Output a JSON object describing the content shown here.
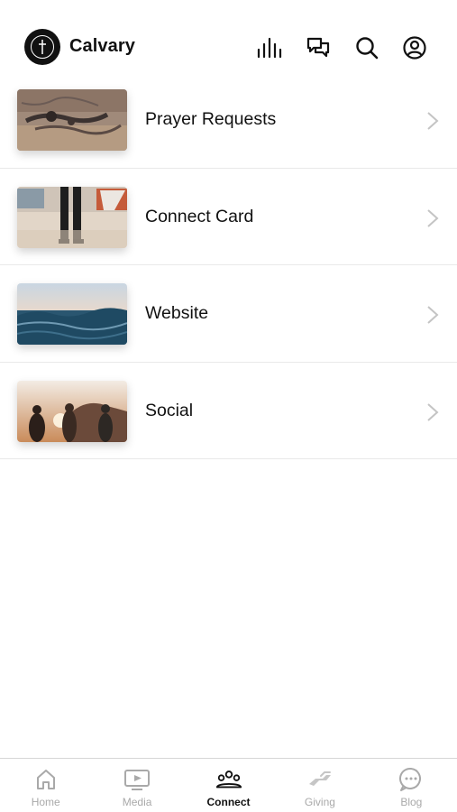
{
  "header": {
    "app_title": "Calvary",
    "icons": [
      "logo-cross-icon",
      "live-bars-icon",
      "chat-icon",
      "search-icon",
      "profile-icon"
    ]
  },
  "list": {
    "items": [
      {
        "label": "Prayer Requests"
      },
      {
        "label": "Connect Card"
      },
      {
        "label": "Website"
      },
      {
        "label": "Social"
      }
    ]
  },
  "tabbar": {
    "active": "Connect",
    "tabs": [
      {
        "label": "Home",
        "icon": "home-icon"
      },
      {
        "label": "Media",
        "icon": "media-icon"
      },
      {
        "label": "Connect",
        "icon": "connect-icon"
      },
      {
        "label": "Giving",
        "icon": "giving-icon"
      },
      {
        "label": "Blog",
        "icon": "blog-icon"
      }
    ]
  },
  "colors": {
    "text": "#111111",
    "inactive_tab": "#a9a9a9",
    "divider": "#e9e9e9",
    "chevron": "#c4c4c4"
  }
}
